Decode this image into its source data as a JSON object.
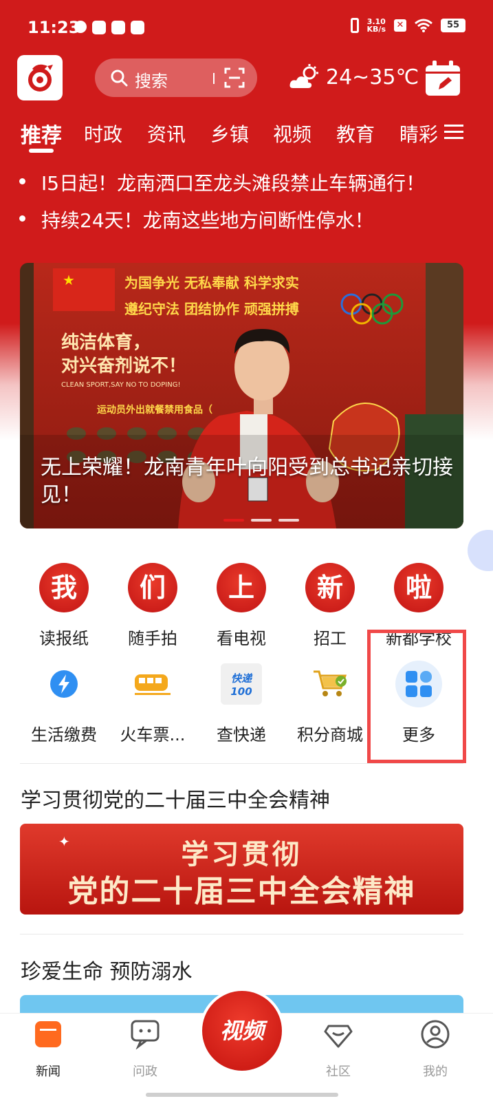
{
  "status_bar": {
    "time": "11:23",
    "net_speed_value": "3.10",
    "net_speed_unit": "KB/s",
    "battery": "55"
  },
  "header": {
    "search_placeholder": "搜索",
    "weather_text": "24~35℃",
    "icons": [
      "app-logo-icon",
      "search-icon",
      "scan-icon",
      "weather-icon",
      "calendar-icon"
    ]
  },
  "tabs": [
    {
      "label": "推荐",
      "active": true
    },
    {
      "label": "时政"
    },
    {
      "label": "资讯"
    },
    {
      "label": "乡镇"
    },
    {
      "label": "视频"
    },
    {
      "label": "教育"
    },
    {
      "label": "睛彩"
    }
  ],
  "headlines": [
    "I5日起！龙南洒口至龙头滩段禁止车辆通行！",
    "持续24天！龙南这些地方间断性停水！"
  ],
  "banner": {
    "caption": "无上荣耀！龙南青年叶向阳受到总书记亲切接见！",
    "wall_text_1": "为国争光 无私奉献 科学求实",
    "wall_text_2": "遵纪守法 团结协作 顽强拼搏",
    "wall_text_3": "纯洁体育，",
    "wall_text_4": "对兴奋剂说不！",
    "wall_text_5": "CLEAN SPORT,SAY NO TO DOPING!",
    "wall_text_6": "运动员外出就餐禁用食品（",
    "slides": 3,
    "active_slide": 0
  },
  "grid": {
    "row1": [
      {
        "glyph": "我",
        "label": "读报纸"
      },
      {
        "glyph": "们",
        "label": "随手拍"
      },
      {
        "glyph": "上",
        "label": "看电视"
      },
      {
        "glyph": "新",
        "label": "招工"
      },
      {
        "glyph": "啦",
        "label": "新都学校"
      }
    ],
    "row2": [
      {
        "icon": "lightning-icon",
        "label": "生活缴费"
      },
      {
        "icon": "train-icon",
        "label": "火车票..."
      },
      {
        "icon": "express-icon",
        "icon_text": "快递100",
        "label": "查快递"
      },
      {
        "icon": "cart-icon",
        "label": "积分商城"
      },
      {
        "icon": "apps-icon",
        "label": "更多"
      }
    ]
  },
  "sections": {
    "study_title": "学习贯彻党的二十届三中全会精神",
    "study_banner_line1": "学习贯彻",
    "study_banner_line2": "党的二十届三中全会精神",
    "drown_title": "珍爱生命 预防溺水"
  },
  "bottom_nav": [
    {
      "label": "新闻",
      "icon": "news-icon",
      "active": true
    },
    {
      "label": "问政",
      "icon": "chat-icon"
    },
    {
      "label": "视频",
      "icon": "video-fab"
    },
    {
      "label": "社区",
      "icon": "community-icon"
    },
    {
      "label": "我的",
      "icon": "profile-icon"
    }
  ],
  "colors": {
    "brand_red": "#d01b1b",
    "highlight_border": "#f04848"
  }
}
